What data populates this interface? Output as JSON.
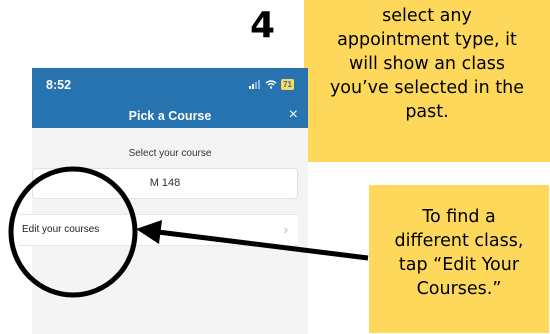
{
  "step_number": "4",
  "callouts": {
    "top_lines": [
      "select any",
      "appointment type, it",
      "will show an class",
      "you’ve selected in the",
      "past."
    ],
    "bottom_lines": [
      "To find a",
      "different class,",
      "tap “Edit Your",
      "Courses.”"
    ]
  },
  "phone": {
    "status_time": "8:52",
    "battery_level": "71",
    "header_title": "Pick a Course",
    "close_icon": "×",
    "section_label": "Select your course",
    "selected_course": "M 148",
    "edit_courses_label": "Edit your courses",
    "chevron_icon": "›"
  },
  "colors": {
    "header_blue": "#2673b0",
    "callout_yellow": "#fdd85b"
  }
}
